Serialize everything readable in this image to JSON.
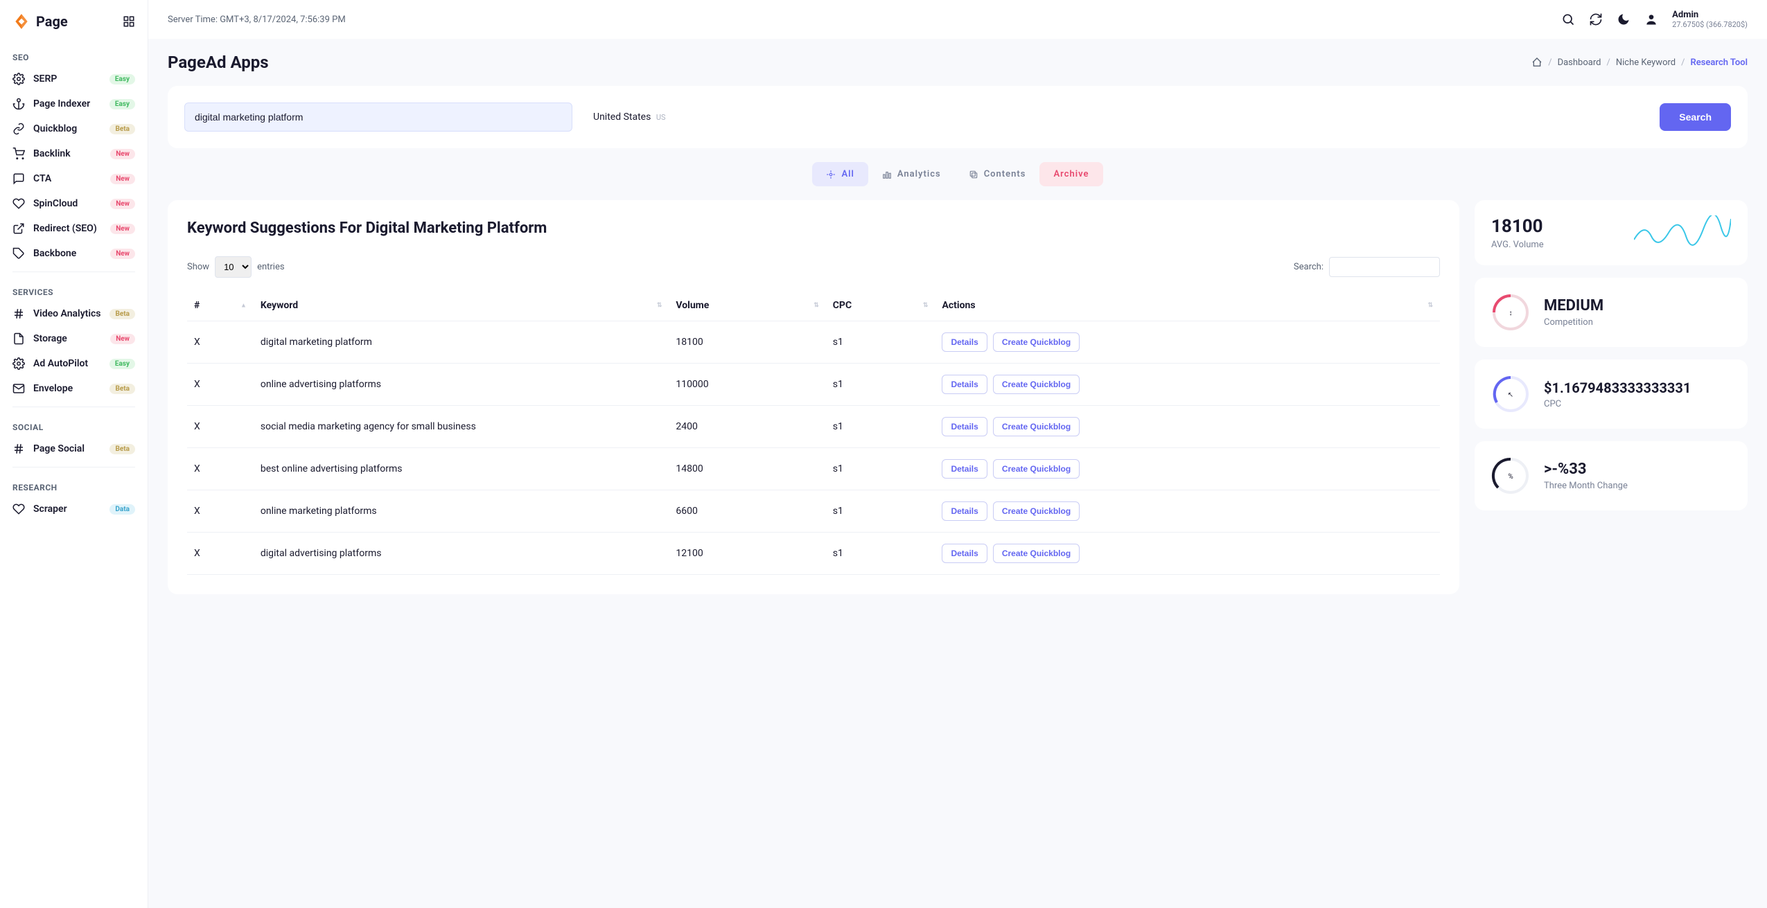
{
  "brand": "Page",
  "server_time": "Server Time: GMT+3, 8/17/2024, 7:56:39 PM",
  "user": {
    "name": "Admin",
    "balance": "27.6750$ (366.7820$)"
  },
  "page_title": "PageAd Apps",
  "breadcrumb": {
    "home": "Dashboard",
    "middle": "Niche Keyword",
    "current": "Research Tool"
  },
  "search": {
    "keyword": "digital marketing platform",
    "country": "United States",
    "country_code": "US",
    "button": "Search"
  },
  "tabs": {
    "all": "All",
    "analytics": "Analytics",
    "contents": "Contents",
    "archive": "Archive"
  },
  "sidebar": {
    "sections": [
      {
        "title": "SEO",
        "items": [
          {
            "label": "SERP",
            "badge": "Easy",
            "badge_class": "easy",
            "icon": "gear"
          },
          {
            "label": "Page Indexer",
            "badge": "Easy",
            "badge_class": "easy",
            "icon": "anchor"
          },
          {
            "label": "Quickblog",
            "badge": "Beta",
            "badge_class": "beta",
            "icon": "link"
          },
          {
            "label": "Backlink",
            "badge": "New",
            "badge_class": "new",
            "icon": "cart"
          },
          {
            "label": "CTA",
            "badge": "New",
            "badge_class": "new",
            "icon": "chat"
          },
          {
            "label": "SpinCloud",
            "badge": "New",
            "badge_class": "new",
            "icon": "heart"
          },
          {
            "label": "Redirect (SEO)",
            "badge": "New",
            "badge_class": "new",
            "icon": "external"
          },
          {
            "label": "Backbone",
            "badge": "New",
            "badge_class": "new",
            "icon": "tag"
          }
        ]
      },
      {
        "title": "SERVICES",
        "items": [
          {
            "label": "Video Analytics",
            "badge": "Beta",
            "badge_class": "beta",
            "icon": "hash"
          },
          {
            "label": "Storage",
            "badge": "New",
            "badge_class": "new",
            "icon": "file"
          },
          {
            "label": "Ad AutoPilot",
            "badge": "Easy",
            "badge_class": "easy",
            "icon": "gear"
          },
          {
            "label": "Envelope",
            "badge": "Beta",
            "badge_class": "beta",
            "icon": "mail"
          }
        ]
      },
      {
        "title": "SOCIAL",
        "items": [
          {
            "label": "Page Social",
            "badge": "Beta",
            "badge_class": "beta",
            "icon": "hash"
          }
        ]
      },
      {
        "title": "RESEARCH",
        "items": [
          {
            "label": "Scraper",
            "badge": "Data",
            "badge_class": "data",
            "icon": "heart"
          }
        ]
      }
    ]
  },
  "table": {
    "title": "Keyword Suggestions For Digital Marketing Platform",
    "show_label": "Show",
    "entries_label": "entries",
    "show_value": "10",
    "search_label": "Search:",
    "headers": {
      "idx": "#",
      "keyword": "Keyword",
      "volume": "Volume",
      "cpc": "CPC",
      "actions": "Actions"
    },
    "actions": {
      "details": "Details",
      "quickblog": "Create Quickblog"
    },
    "rows": [
      {
        "idx": "X",
        "keyword": "digital marketing platform",
        "volume": "18100",
        "cpc": "s1"
      },
      {
        "idx": "X",
        "keyword": "online advertising platforms",
        "volume": "110000",
        "cpc": "s1"
      },
      {
        "idx": "X",
        "keyword": "social media marketing agency for small business",
        "volume": "2400",
        "cpc": "s1"
      },
      {
        "idx": "X",
        "keyword": "best online advertising platforms",
        "volume": "14800",
        "cpc": "s1"
      },
      {
        "idx": "X",
        "keyword": "online marketing platforms",
        "volume": "6600",
        "cpc": "s1"
      },
      {
        "idx": "X",
        "keyword": "digital advertising platforms",
        "volume": "12100",
        "cpc": "s1"
      }
    ]
  },
  "stats": {
    "volume": {
      "value": "18100",
      "label": "AVG. Volume"
    },
    "competition": {
      "value": "MEDIUM",
      "label": "Competition"
    },
    "cpc": {
      "value": "$1.1679483333333331",
      "label": "CPC"
    },
    "change": {
      "value": ">-%33",
      "label": "Three Month Change"
    }
  },
  "colors": {
    "primary": "#6366f1",
    "danger": "#e84a6f"
  }
}
